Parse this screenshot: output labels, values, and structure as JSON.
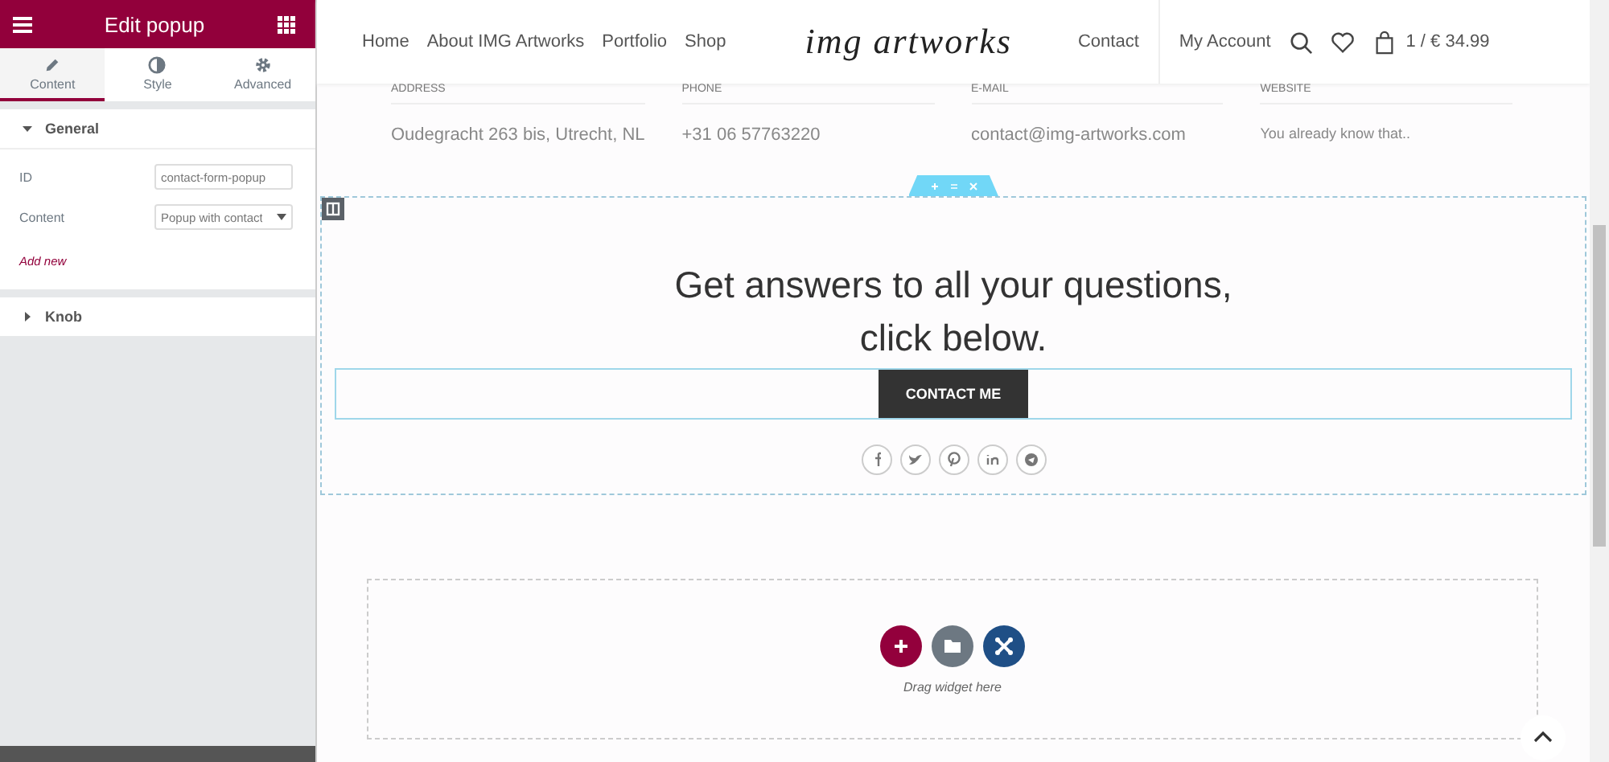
{
  "panel": {
    "title": "Edit popup",
    "tabs": [
      {
        "label": "Content",
        "selected": true
      },
      {
        "label": "Style",
        "selected": false
      },
      {
        "label": "Advanced",
        "selected": false
      }
    ],
    "sections": [
      {
        "title": "General",
        "expanded": true,
        "fields": [
          {
            "label": "ID",
            "kind": "text",
            "value": "contact-form-popup"
          },
          {
            "label": "Content",
            "kind": "select",
            "value": "Popup with contact"
          }
        ],
        "link": "Add new"
      },
      {
        "title": "Knob",
        "expanded": false
      }
    ]
  },
  "site": {
    "nav_left": [
      "Home",
      "About IMG Artworks",
      "Portfolio",
      "Shop"
    ],
    "logo": "img artworks",
    "nav_right": [
      "Contact",
      "My Account"
    ],
    "cart": "1 / € 34.99",
    "info": [
      {
        "label": "ADDRESS",
        "value": "Oudegracht 263 bis, Utrecht, NL"
      },
      {
        "label": "PHONE",
        "value": "+31 06 57763220"
      },
      {
        "label": "E-MAIL",
        "value": "contact@img-artworks.com"
      },
      {
        "label": "WEBSITE",
        "value": "You already know that.."
      }
    ],
    "popup": {
      "heading": [
        "Get answers to all your questions,",
        "click below."
      ],
      "button": "CONTACT ME"
    },
    "dropzone": {
      "hint": "Drag widget here"
    }
  }
}
